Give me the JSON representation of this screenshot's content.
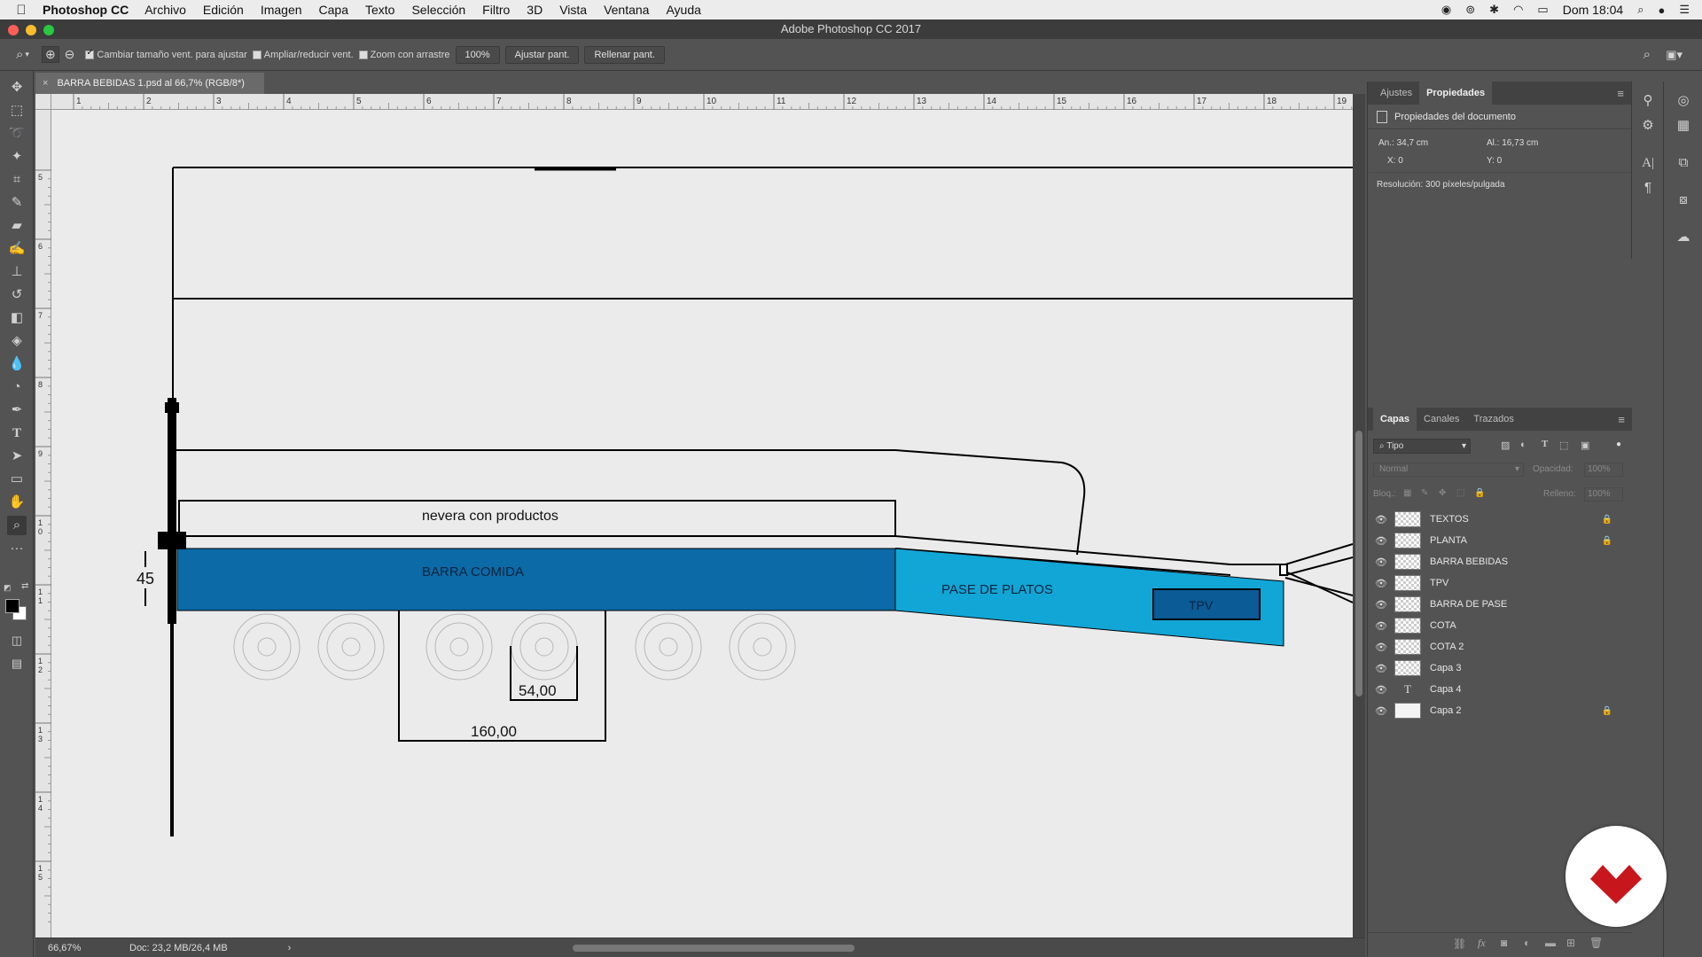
{
  "menubar": {
    "app": "Photoshop CC",
    "items": [
      "Archivo",
      "Edición",
      "Imagen",
      "Capa",
      "Texto",
      "Selección",
      "Filtro",
      "3D",
      "Vista",
      "Ventana",
      "Ayuda"
    ],
    "clock": "Dom 18:04"
  },
  "window": {
    "title": "Adobe Photoshop CC 2017"
  },
  "options": {
    "resize_windows": "Cambiar tamaño vent. para ajustar",
    "zoom_all": "Ampliar/reducir vent.",
    "scrubby_zoom": "Zoom con arrastre",
    "zoom_value": "100%",
    "fit_screen": "Ajustar pant.",
    "fill_screen": "Rellenar pant."
  },
  "document": {
    "tab_title": "BARRA BEBIDAS 1.psd al 66,7% (RGB/8*)"
  },
  "ruler": {
    "top_labels": [
      "1",
      "2",
      "3",
      "4",
      "5",
      "6",
      "7",
      "8",
      "9",
      "10",
      "11",
      "12",
      "13",
      "14",
      "15",
      "16",
      "17",
      "18",
      "19"
    ],
    "left_labels": [
      "5",
      "6",
      "7",
      "8",
      "9",
      "1\n0",
      "1\n1",
      "1\n2",
      "1\n3",
      "1\n4",
      "1\n5"
    ]
  },
  "drawing": {
    "fridge_label": "nevera con productos",
    "bar_label": "BARRA COMIDA",
    "pass_label": "PASE DE PLATOS",
    "tpv_label": "TPV",
    "dim_height": "45",
    "dim_small": "54,00",
    "dim_large": "160,00",
    "colors": {
      "bar": "#0c6aa6",
      "pass": "#12a6d6",
      "tpv": "#0b5b96"
    }
  },
  "status": {
    "zoom": "66,67%",
    "doc_size": "Doc: 23,2 MB/26,4 MB"
  },
  "properties_panel": {
    "tabs": [
      "Ajustes",
      "Propiedades"
    ],
    "section": "Propiedades del documento",
    "width": "An.: 34,7 cm",
    "height": "Al.: 16,73 cm",
    "x": "X: 0",
    "y": "Y: 0",
    "resolution": "Resolución: 300 píxeles/pulgada"
  },
  "layers_panel": {
    "tabs": [
      "Capas",
      "Canales",
      "Trazados"
    ],
    "filter": "Tipo",
    "blend_mode": "Normal",
    "opacity_label": "Opacidad:",
    "opacity_value": "100%",
    "lock_label": "Bloq.:",
    "fill_label": "Relleno:",
    "fill_value": "100%",
    "layers": [
      {
        "name": "TEXTOS",
        "locked": true,
        "kind": "checker"
      },
      {
        "name": "PLANTA",
        "locked": true,
        "kind": "checker"
      },
      {
        "name": "BARRA BEBIDAS",
        "locked": false,
        "kind": "checker"
      },
      {
        "name": "TPV",
        "locked": false,
        "kind": "checker"
      },
      {
        "name": "BARRA DE PASE",
        "locked": false,
        "kind": "checker"
      },
      {
        "name": "COTA",
        "locked": false,
        "kind": "checker"
      },
      {
        "name": "COTA 2",
        "locked": false,
        "kind": "checker"
      },
      {
        "name": "Capa 3",
        "locked": false,
        "kind": "checker"
      },
      {
        "name": "Capa 4",
        "locked": false,
        "kind": "text"
      },
      {
        "name": "Capa 2",
        "locked": true,
        "kind": "solid"
      }
    ]
  }
}
